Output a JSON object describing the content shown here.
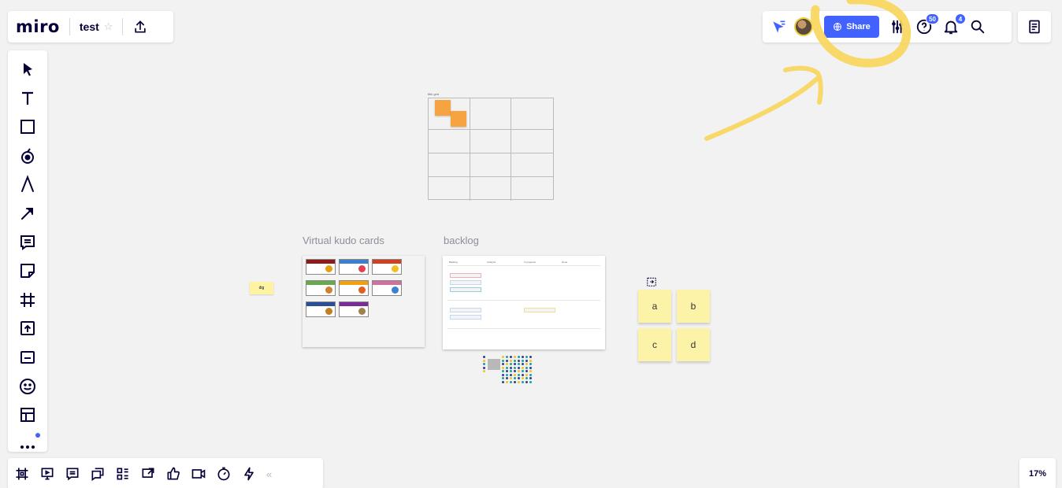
{
  "app": {
    "logo": "miro",
    "board_title": "test",
    "star_icon": "star-icon"
  },
  "header": {
    "share_label": "Share",
    "help_badge": "50",
    "notifications_badge": "4",
    "zoom_level": "17%"
  },
  "canvas": {
    "grid_label": "title grid",
    "kudo_title": "Virtual kudo cards",
    "backlog_title": "backlog",
    "dig_note": "dig",
    "sticky_notes": [
      "a",
      "b",
      "c",
      "d"
    ],
    "backlog_headers": [
      "Backlog",
      "Analysis",
      "In progress",
      "Done"
    ],
    "kudo_cards": [
      {
        "color": "#8b1a1a",
        "art": "#e0a010"
      },
      {
        "color": "#3a7fd0",
        "art": "#e04050"
      },
      {
        "color": "#d04020",
        "art": "#f0c020"
      },
      {
        "color": "#6aa84f",
        "art": "#d08030"
      },
      {
        "color": "#f0a010",
        "art": "#e06020"
      },
      {
        "color": "#d070a0",
        "art": "#4080d0"
      },
      {
        "color": "#2a4f9a",
        "art": "#c08020"
      },
      {
        "color": "#7b2a9a",
        "art": "#a08050"
      }
    ]
  },
  "colors": {
    "accent": "#4262ff",
    "annotation": "#f7d55a",
    "sticky_yellow": "#fdf3a8",
    "sticky_orange": "#f6a342"
  }
}
